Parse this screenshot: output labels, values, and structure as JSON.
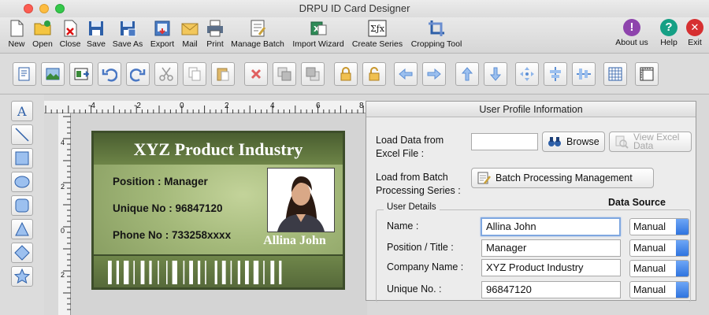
{
  "window": {
    "title": "DRPU ID Card Designer"
  },
  "toolbar": {
    "items": [
      {
        "label": "New",
        "icon": "new-file-icon"
      },
      {
        "label": "Open",
        "icon": "open-folder-icon"
      },
      {
        "label": "Close",
        "icon": "close-file-icon"
      },
      {
        "label": "Save",
        "icon": "save-icon"
      },
      {
        "label": "Save As",
        "icon": "save-as-icon"
      },
      {
        "label": "Export",
        "icon": "export-icon"
      },
      {
        "label": "Mail",
        "icon": "mail-icon"
      },
      {
        "label": "Print",
        "icon": "print-icon"
      },
      {
        "label": "Manage Batch",
        "icon": "manage-batch-icon"
      },
      {
        "label": "Import Wizard",
        "icon": "import-wizard-icon"
      },
      {
        "label": "Create Series",
        "icon": "create-series-icon"
      },
      {
        "label": "Cropping Tool",
        "icon": "cropping-tool-icon"
      }
    ],
    "right": [
      {
        "label": "About us",
        "glyph": "!",
        "color": "#8e44ad"
      },
      {
        "label": "Help",
        "glyph": "?",
        "color": "#16a085"
      },
      {
        "label": "Exit",
        "glyph": "✕",
        "color": "#d63031"
      }
    ]
  },
  "ruler": {
    "top_ticks": [
      "-4",
      "-2",
      "0",
      "2",
      "4",
      "6",
      "8",
      "10",
      "12"
    ],
    "left_ticks": [
      "4",
      "2",
      "0",
      "2"
    ]
  },
  "card": {
    "company": "XYZ Product Industry",
    "position_line": "Position :  Manager",
    "unique_line": "Unique No :  96847120",
    "phone_line": "Phone No :  733258xxxx",
    "name": "Allina John"
  },
  "panel": {
    "title": "User Profile Information",
    "load_excel_label": "Load Data from\nExcel File :",
    "browse_label": "Browse",
    "view_excel_label": "View Excel\nData",
    "batch_label": "Load from Batch\nProcessing Series :",
    "batch_button": "Batch Processing Management",
    "user_details_legend": "User Details",
    "data_source_header": "Data Source",
    "fields": [
      {
        "label": "Name :",
        "value": "Allina John",
        "source": "Manual"
      },
      {
        "label": "Position / Title :",
        "value": "Manager",
        "source": "Manual"
      },
      {
        "label": "Company Name :",
        "value": "XYZ Product Industry",
        "source": "Manual"
      },
      {
        "label": "Unique No. :",
        "value": "96847120",
        "source": "Manual"
      }
    ]
  }
}
